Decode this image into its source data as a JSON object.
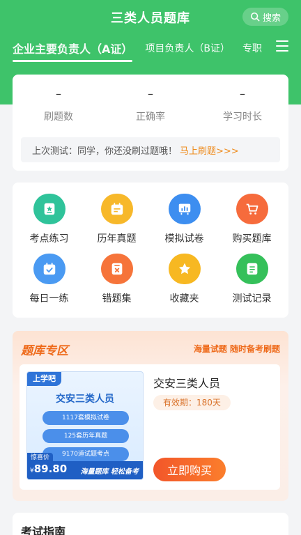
{
  "header": {
    "title": "三类人员题库",
    "search_label": "搜索",
    "tabs": [
      "企业主要负责人（A证）",
      "项目负责人（B证）",
      "专职"
    ]
  },
  "stats": {
    "items": [
      {
        "value": "–",
        "label": "刷题数"
      },
      {
        "value": "–",
        "label": "正确率"
      },
      {
        "value": "–",
        "label": "学习时长"
      }
    ],
    "last_test_text": "上次测试：同学，你还没刷过题哦！",
    "last_test_link": "马上刷题>>>"
  },
  "functions": [
    {
      "label": "考点练习",
      "icon": "star-doc-icon",
      "color": "#2fc39a"
    },
    {
      "label": "历年真题",
      "icon": "calendar-doc-icon",
      "color": "#f7b82a"
    },
    {
      "label": "模拟试卷",
      "icon": "board-chart-icon",
      "color": "#3d8ef0"
    },
    {
      "label": "购买题库",
      "icon": "cart-icon",
      "color": "#f66b3c"
    },
    {
      "label": "每日一练",
      "icon": "calendar-check-icon",
      "color": "#4a9af2"
    },
    {
      "label": "错题集",
      "icon": "wrong-doc-icon",
      "color": "#f6743a"
    },
    {
      "label": "收藏夹",
      "icon": "star-icon",
      "color": "#f7b822"
    },
    {
      "label": "测试记录",
      "icon": "record-icon",
      "color": "#35c05a"
    }
  ],
  "zone": {
    "title": "题库专区",
    "subtitle": "海量试题 随时备考刷题",
    "product": {
      "cover_brand": "上学吧",
      "cover_title": "交安三类人员",
      "cover_pills": [
        "1117套模拟试卷",
        "125套历年真题",
        "9170道试题考点"
      ],
      "price_label": "惊喜价",
      "price_symbol": "¥",
      "price": "89.80",
      "cover_slogan": "海量题库 轻松备考",
      "name": "交安三类人员",
      "validity": "有效期：180天",
      "buy_label": "立即购买"
    }
  },
  "guide": {
    "title": "考试指南"
  }
}
